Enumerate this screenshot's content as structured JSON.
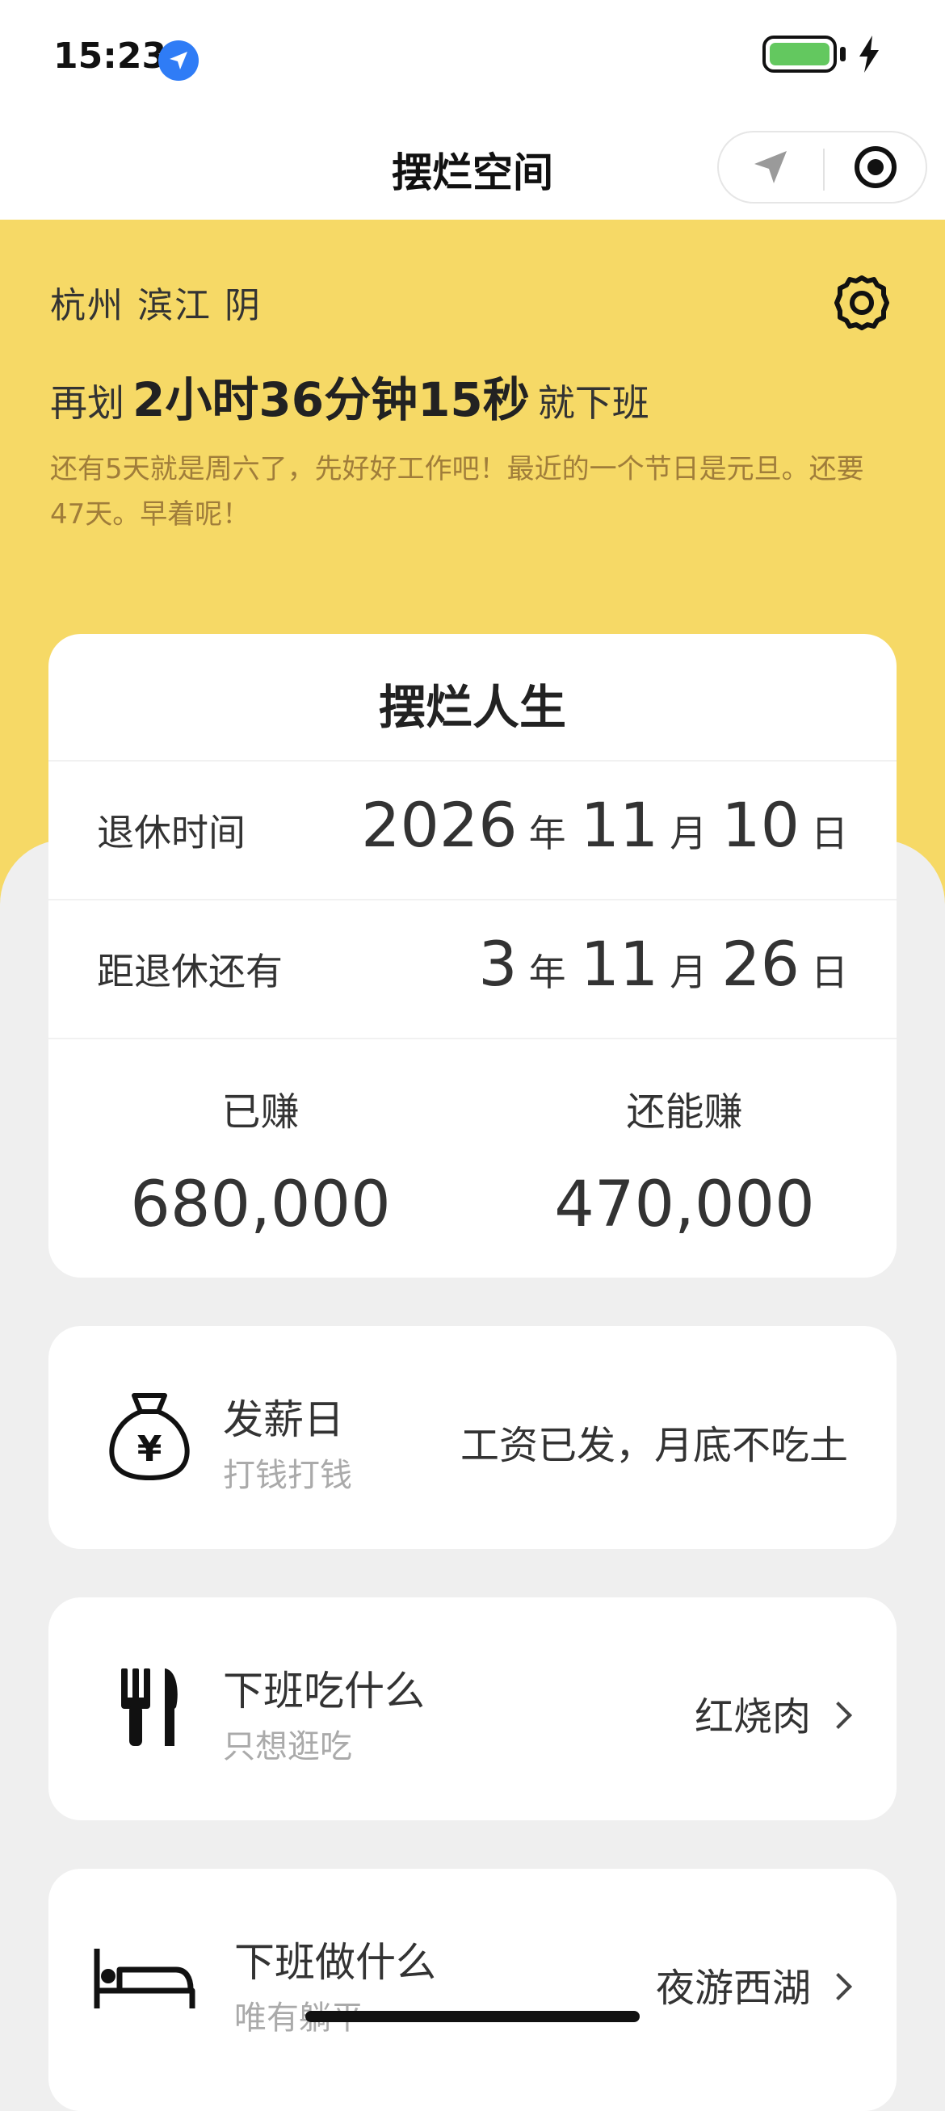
{
  "status_bar": {
    "time": "15:23"
  },
  "navbar": {
    "title": "摆烂空间"
  },
  "header": {
    "location": "杭州 滨江 阴",
    "countdown_prefix": "再划",
    "countdown_time": "2小时36分钟15秒",
    "countdown_suffix": "就下班",
    "notice": "还有5天就是周六了，先好好工作吧！最近的一个节日是元旦。还要47天。早着呢！"
  },
  "life_card": {
    "title": "摆烂人生",
    "retire_date": {
      "label": "退休时间",
      "year": "2026",
      "year_unit": "年",
      "month": "11",
      "month_unit": "月",
      "day": "10",
      "day_unit": "日"
    },
    "until_retire": {
      "label": "距退休还有",
      "years": "3",
      "years_unit": "年",
      "months": "11",
      "months_unit": "月",
      "days": "26",
      "days_unit": "日"
    },
    "earned": {
      "label": "已赚",
      "value": "680,000"
    },
    "can_earn": {
      "label": "还能赚",
      "value": "470,000"
    }
  },
  "list": [
    {
      "icon": "money-bag-icon",
      "title": "发薪日",
      "subtitle": "打钱打钱",
      "value": "工资已发，月底不吃土"
    },
    {
      "icon": "utensils-icon",
      "title": "下班吃什么",
      "subtitle": "只想逛吃",
      "value": "红烧肉"
    },
    {
      "icon": "bed-icon",
      "title": "下班做什么",
      "subtitle": "唯有躺平",
      "value": "夜游西湖"
    }
  ],
  "colors": {
    "header_yellow": "#f6d966",
    "notice_brown": "#a07d3a",
    "background": "#efefef"
  }
}
